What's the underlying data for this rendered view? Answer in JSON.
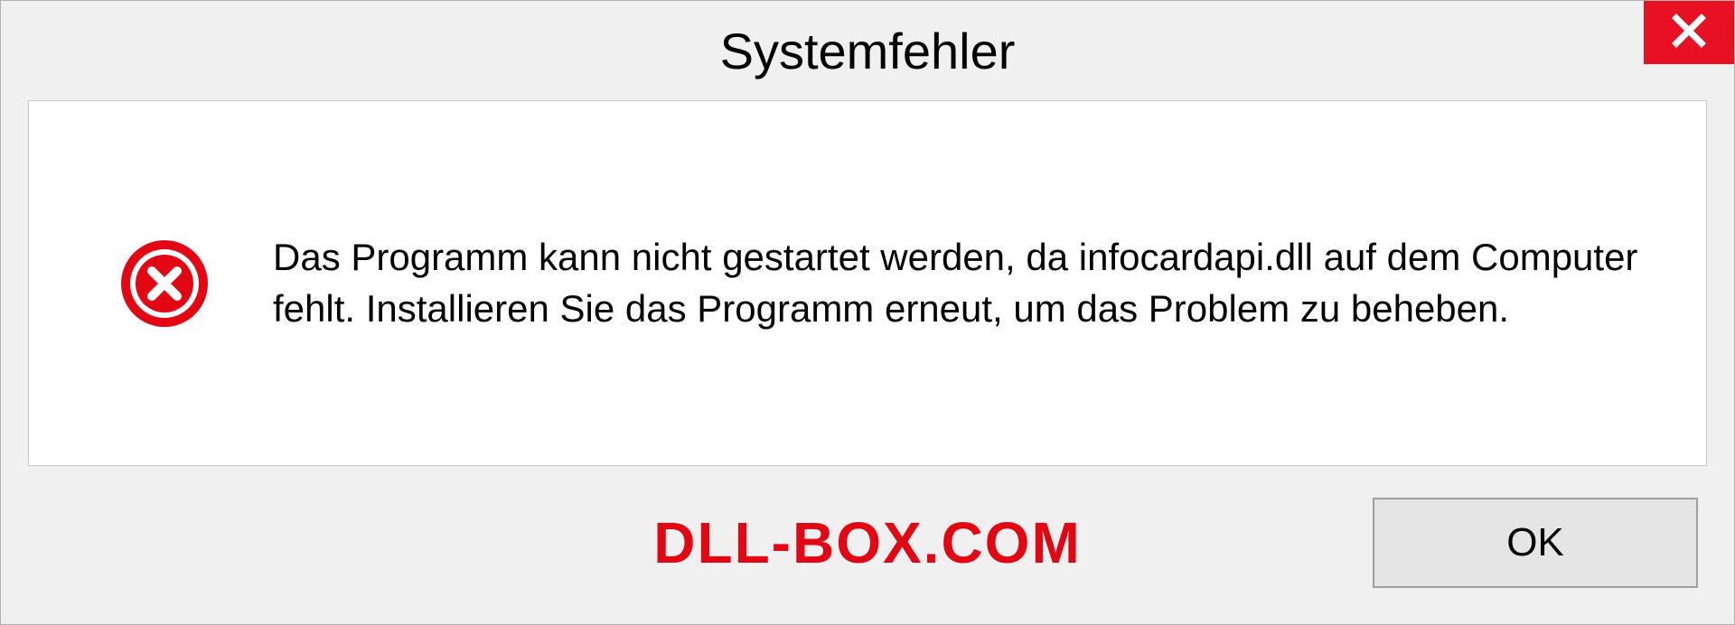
{
  "dialog": {
    "title": "Systemfehler",
    "message": "Das Programm kann nicht gestartet werden, da infocardapi.dll auf dem Computer fehlt. Installieren Sie das Programm erneut, um das Problem zu beheben.",
    "ok_label": "OK"
  },
  "watermark": {
    "text": "DLL-BOX.COM"
  },
  "colors": {
    "close_button": "#e81123",
    "error_icon": "#e30613",
    "watermark": "#e30613"
  }
}
